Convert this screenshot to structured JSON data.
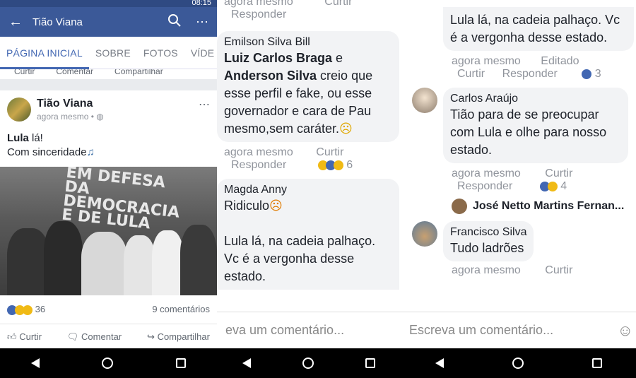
{
  "panel1": {
    "status_time": "08:15",
    "page_title": "Tião Viana",
    "tabs": [
      "PÁGINA INICIAL",
      "SOBRE",
      "FOTOS",
      "VÍDE"
    ],
    "cut_actions": [
      "Curtir",
      "Comentar",
      "Compartilhar"
    ],
    "post": {
      "author": "Tião Viana",
      "time": "agora mesmo •",
      "text_bold": "Lula",
      "text_line1_rest": " lá!",
      "text_line2": "Com sinceridade",
      "photo_banner": "EM DEFESA DA DEMOCRACIA E DE LULA",
      "reaction_count": "36",
      "comments_count": "9 comentários",
      "actions": [
        "Curtir",
        "Comentar",
        "Compartilhar"
      ]
    }
  },
  "panel2": {
    "top_meta": "agora mesmo",
    "top_like": "Curtir",
    "top_reply": "Responder",
    "c1": {
      "name": "Emilson Silva Bill",
      "mention1": "Luiz Carlos Braga",
      "conj": " e",
      "mention2": "Anderson Silva",
      "text": " creio que esse perfil e fake, ou esse governador e cara de Pau mesmo,sem caráter.",
      "time": "agora mesmo",
      "like": "Curtir",
      "reply": "Responder",
      "reactions": "6"
    },
    "c2": {
      "name": "Magda Anny",
      "text1": "Ridiculo",
      "text2": "Lula lá, na cadeia palhaço. Vc é a vergonha desse estado."
    },
    "input_placeholder": "eva um comentário..."
  },
  "panel3": {
    "c0": {
      "text": "Lula lá, na cadeia palhaço. Vc é a vergonha desse estado.",
      "time": "agora mesmo",
      "edited": "Editado",
      "like": "Curtir",
      "reply": "Responder",
      "reactions": "3"
    },
    "c1": {
      "name": "Carlos Araújo",
      "text": "Tião para de se preocupar com Lula e olhe para nosso estado.",
      "time": "agora mesmo",
      "like": "Curtir",
      "reply": "Responder",
      "reactions": "4"
    },
    "reply_author": "José Netto Martins Fernan...",
    "c2": {
      "name": "Francisco Silva",
      "text": "Tudo ladrões",
      "time": "agora mesmo",
      "like": "Curtir"
    },
    "input_placeholder": "Escreva um comentário..."
  }
}
